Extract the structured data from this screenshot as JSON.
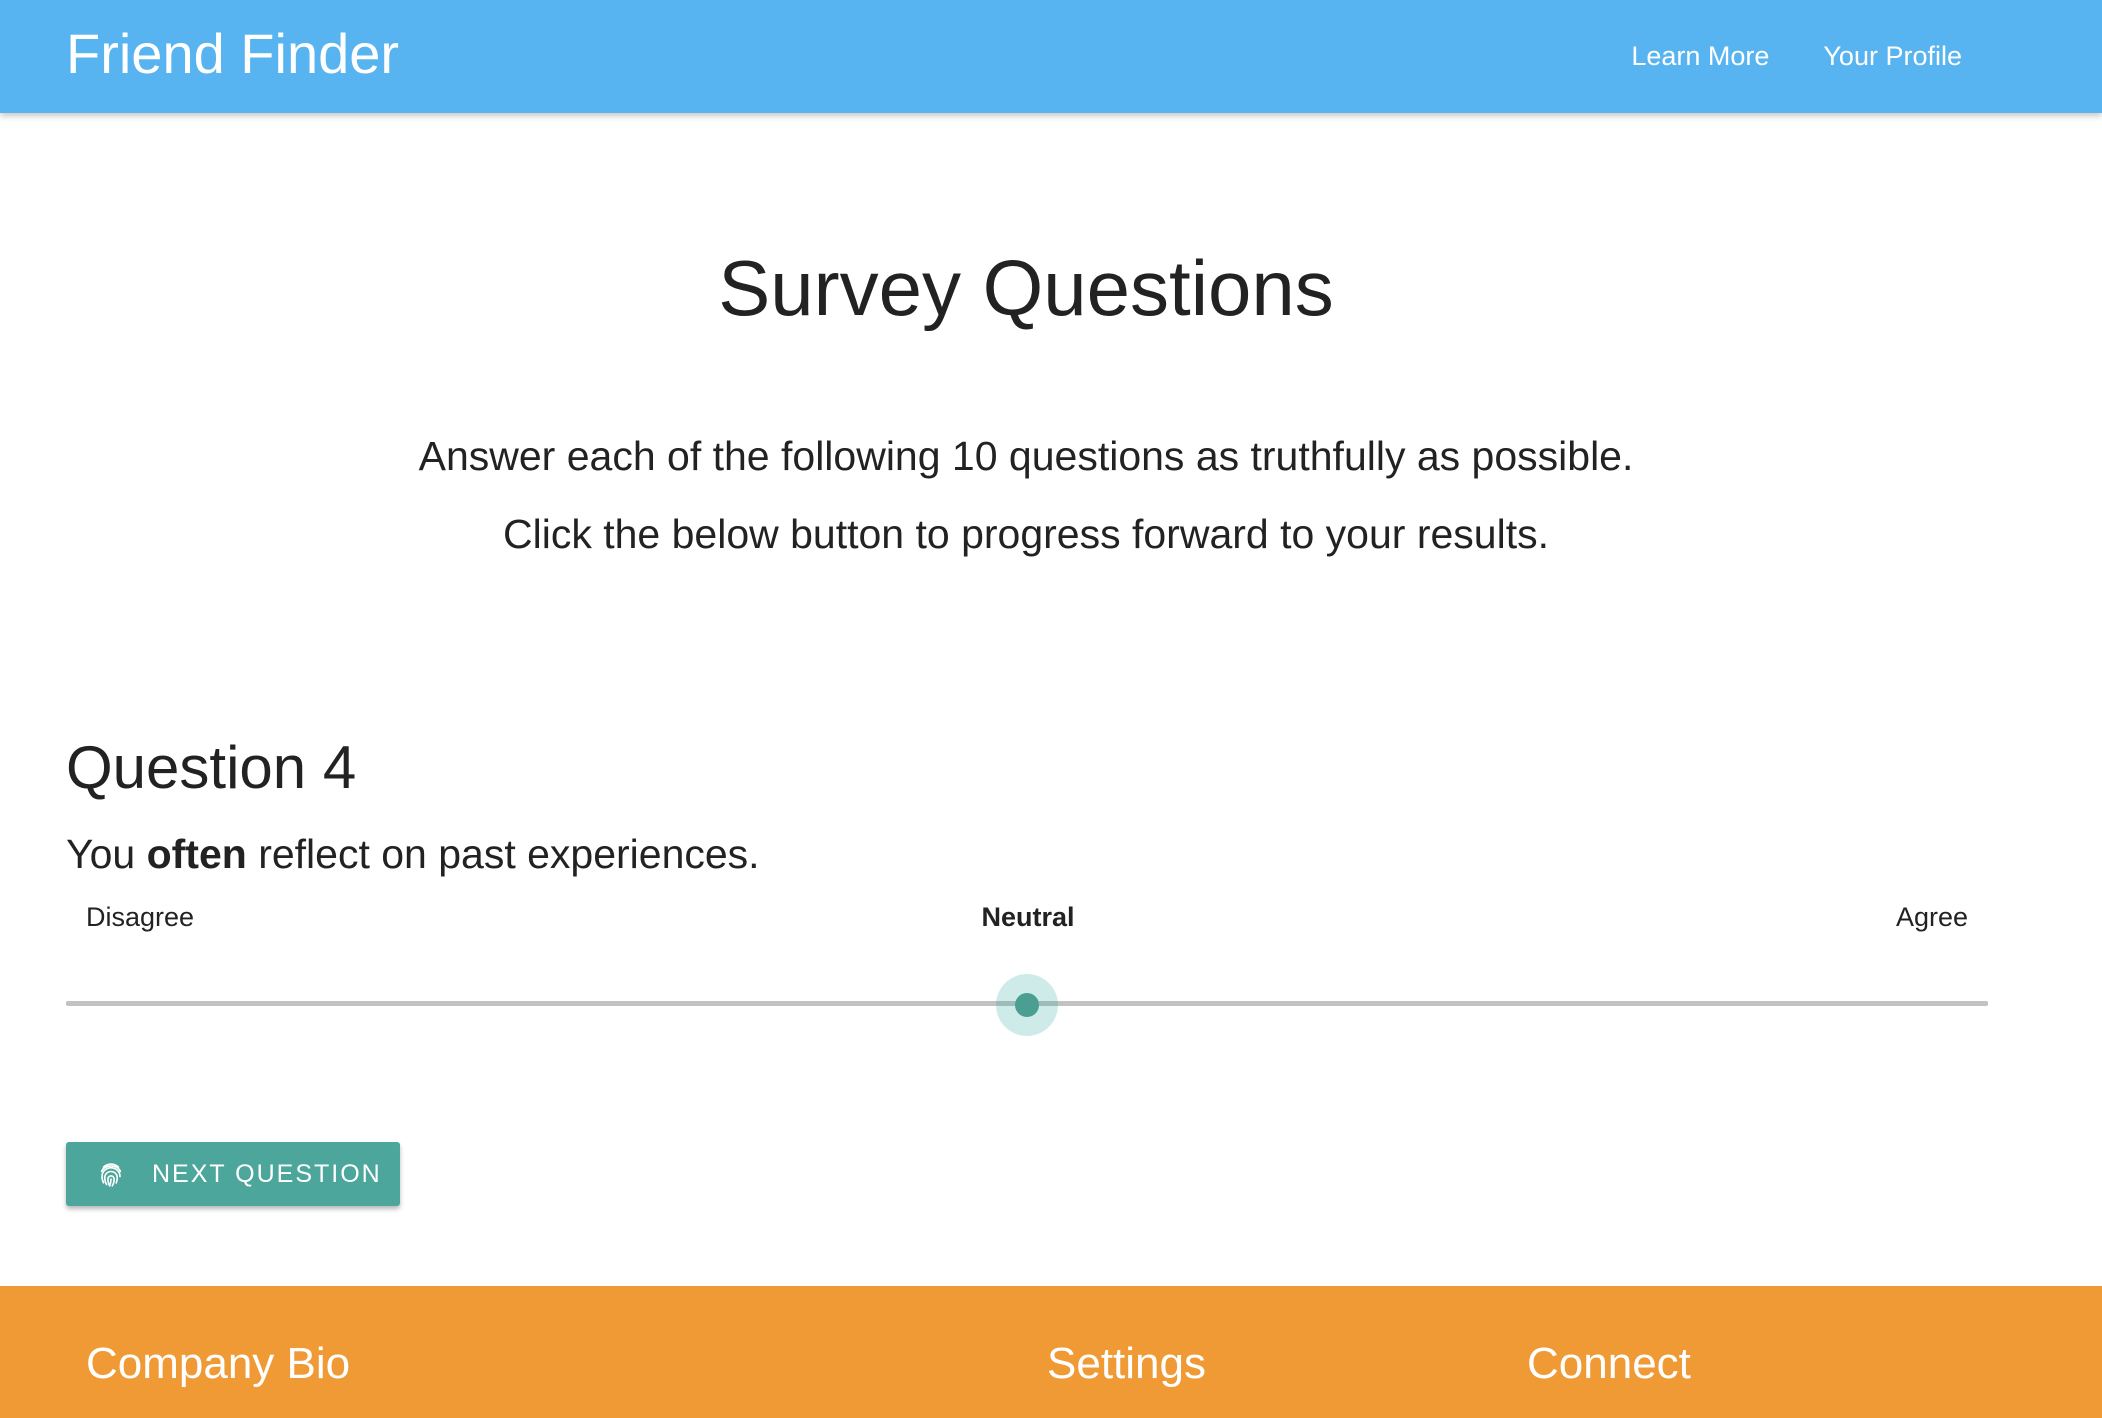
{
  "navbar": {
    "brand": "Friend Finder",
    "links": [
      {
        "label": "Learn More"
      },
      {
        "label": "Your Profile"
      }
    ],
    "color": "#58b4f0"
  },
  "main": {
    "title": "Survey Questions",
    "intro_lines": [
      "Answer each of the following 10 questions as truthfully as possible.",
      "Click the below button to progress forward to your results."
    ]
  },
  "question": {
    "title": "Question 4",
    "text_before": "You ",
    "text_emphasis": "often",
    "text_after": " reflect on past experiences.",
    "scale": {
      "left_label": "Disagree",
      "center_label": "Neutral",
      "right_label": "Agree"
    },
    "slider_value": 0.5,
    "accent_color": "#4da69b"
  },
  "actions": {
    "next_label": "NEXT QUESTION",
    "next_icon": "fingerprint-icon"
  },
  "footer": {
    "color": "#f09a36",
    "headings": [
      "Company Bio",
      "Settings",
      "Connect"
    ]
  }
}
